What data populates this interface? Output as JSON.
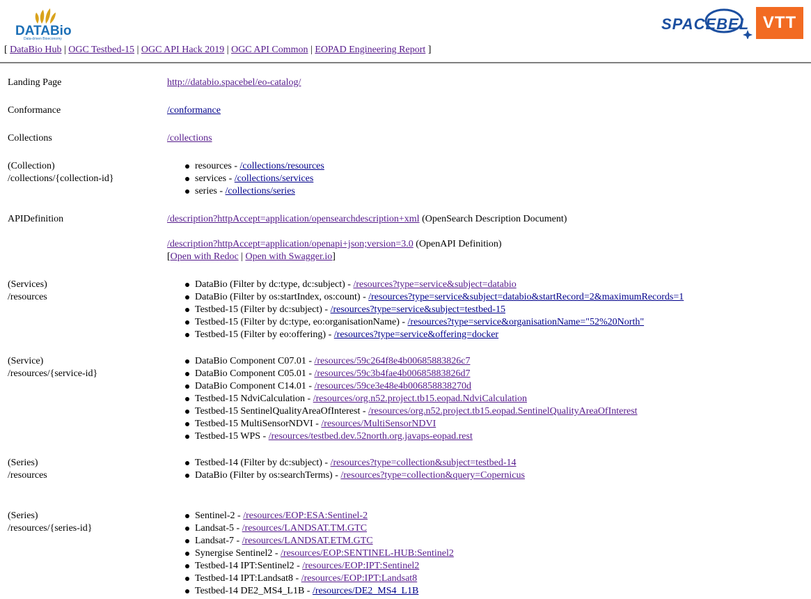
{
  "header": {
    "databio_logo": {
      "name": "DATABio",
      "tagline": "Data-driven Bioeconomy"
    },
    "spacebel_logo": {
      "name": "SPACEBEL"
    },
    "vtt_logo": {
      "name": "VTT",
      "color": "#f26b22"
    },
    "nav": [
      {
        "label": "DataBio Hub"
      },
      {
        "label": "OGC Testbed-15"
      },
      {
        "label": "OGC API Hack 2019"
      },
      {
        "label": "OGC API Common"
      },
      {
        "label": "EOPAD Engineering Report"
      }
    ]
  },
  "rows": {
    "landing": {
      "label": "Landing Page",
      "link": "http://databio.spacebel/eo-catalog/"
    },
    "conformance": {
      "label": "Conformance",
      "link": "/conformance"
    },
    "collections": {
      "label": "Collections",
      "link": "/collections"
    },
    "collection": {
      "label1": "(Collection)",
      "label2": "/collections/{collection-id}",
      "items": [
        {
          "text": "resources - ",
          "link": "/collections/resources"
        },
        {
          "text": "services - ",
          "link": "/collections/services"
        },
        {
          "text": "series - ",
          "link": "/collections/series"
        }
      ]
    },
    "api": {
      "label": "APIDefinition",
      "link1": "/description?httpAccept=application/opensearchdescription+xml",
      "desc1": " (OpenSearch Description Document)",
      "link2": "/description?httpAccept=application/openapi+json;version=3.0",
      "desc2": " (OpenAPI Definition)",
      "redoc": "Open with Redoc",
      "swagger": "Open with Swagger.io"
    },
    "services": {
      "label1": "(Services)",
      "label2": "/resources",
      "items": [
        {
          "text": "DataBio (Filter by dc:type, dc:subject) - ",
          "link": "/resources?type=service&subject=databio"
        },
        {
          "text": "DataBio (Filter by os:startIndex, os:count) - ",
          "link": "/resources?type=service&subject=databio&startRecord=2&maximumRecords=1"
        },
        {
          "text": "Testbed-15 (Filter by dc:subject) - ",
          "link": "/resources?type=service&subject=testbed-15"
        },
        {
          "text": "Testbed-15 (Filter by dc:type, eo:organisationName) - ",
          "link": "/resources?type=service&organisationName=\"52%20North\""
        },
        {
          "text": "Testbed-15 (Filter by eo:offering) - ",
          "link": "/resources?type=service&offering=docker"
        }
      ]
    },
    "service": {
      "label1": "(Service)",
      "label2": "/resources/{service-id}",
      "items": [
        {
          "text": "DataBio Component C07.01 - ",
          "link": "/resources/59c264f8e4b00685883826c7"
        },
        {
          "text": "DataBio Component C05.01 - ",
          "link": "/resources/59c3b4fae4b00685883826d7"
        },
        {
          "text": "DataBio Component C14.01 - ",
          "link": "/resources/59ce3e48e4b006858838270d"
        },
        {
          "text": "Testbed-15 NdviCalculation - ",
          "link": "/resources/org.n52.project.tb15.eopad.NdviCalculation"
        },
        {
          "text": "Testbed-15 SentinelQualityAreaOfInterest - ",
          "link": "/resources/org.n52.project.tb15.eopad.SentinelQualityAreaOfInterest"
        },
        {
          "text": "Testbed-15 MultiSensorNDVI - ",
          "link": "/resources/MultiSensorNDVI"
        },
        {
          "text": "Testbed-15 WPS - ",
          "link": "/resources/testbed.dev.52north.org.javaps-eopad.rest"
        }
      ]
    },
    "series": {
      "label1": "(Series)",
      "label2": "/resources",
      "items": [
        {
          "text": "Testbed-14 (Filter by dc:subject) - ",
          "link": "/resources?type=collection&subject=testbed-14"
        },
        {
          "text": "DataBio (Filter by os:searchTerms) - ",
          "link": "/resources?type=collection&query=Copernicus"
        }
      ]
    },
    "series_id": {
      "label1": "(Series)",
      "label2": "/resources/{series-id}",
      "items": [
        {
          "text": "Sentinel-2 - ",
          "link": "/resources/EOP:ESA:Sentinel-2"
        },
        {
          "text": "Landsat-5 - ",
          "link": "/resources/LANDSAT.TM.GTC"
        },
        {
          "text": "Landsat-7 - ",
          "link": "/resources/LANDSAT.ETM.GTC"
        },
        {
          "text": "Synergise Sentinel2 - ",
          "link": "/resources/EOP:SENTINEL-HUB:Sentinel2"
        },
        {
          "text": "Testbed-14 IPT:Sentinel2 - ",
          "link": "/resources/EOP:IPT:Sentinel2"
        },
        {
          "text": "Testbed-14 IPT:Landsat8 - ",
          "link": "/resources/EOP:IPT:Landsat8"
        },
        {
          "text": "Testbed-14 DE2_MS4_L1B - ",
          "link": "/resources/DE2_MS4_L1B"
        }
      ]
    }
  }
}
